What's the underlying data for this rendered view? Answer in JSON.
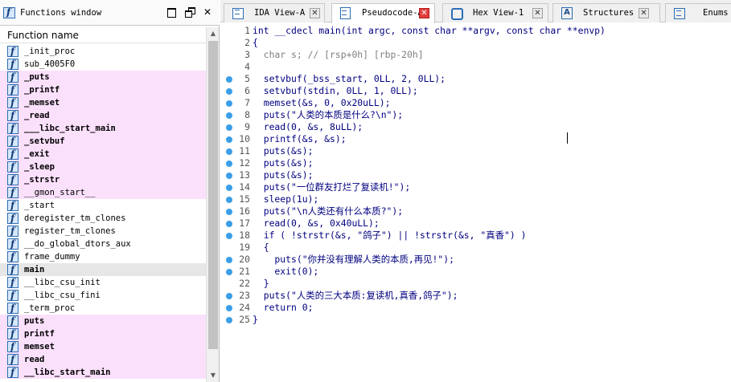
{
  "functions_window": {
    "title": "Functions window",
    "column_header": "Function name",
    "items": [
      {
        "name": "_init_proc",
        "kind": "normal"
      },
      {
        "name": "sub_4005F0",
        "kind": "normal"
      },
      {
        "name": "_puts",
        "kind": "lib"
      },
      {
        "name": "_printf",
        "kind": "lib"
      },
      {
        "name": "_memset",
        "kind": "lib"
      },
      {
        "name": "_read",
        "kind": "lib"
      },
      {
        "name": "___libc_start_main",
        "kind": "lib"
      },
      {
        "name": "_setvbuf",
        "kind": "lib"
      },
      {
        "name": "_exit",
        "kind": "lib"
      },
      {
        "name": "_sleep",
        "kind": "lib"
      },
      {
        "name": "_strstr",
        "kind": "lib"
      },
      {
        "name": "__gmon_start__",
        "kind": "lib_plain"
      },
      {
        "name": "_start",
        "kind": "normal"
      },
      {
        "name": "deregister_tm_clones",
        "kind": "normal"
      },
      {
        "name": "register_tm_clones",
        "kind": "normal"
      },
      {
        "name": "__do_global_dtors_aux",
        "kind": "normal"
      },
      {
        "name": "frame_dummy",
        "kind": "normal"
      },
      {
        "name": "main",
        "kind": "selected"
      },
      {
        "name": "__libc_csu_init",
        "kind": "normal"
      },
      {
        "name": "__libc_csu_fini",
        "kind": "normal"
      },
      {
        "name": "_term_proc",
        "kind": "normal"
      },
      {
        "name": "puts",
        "kind": "lib"
      },
      {
        "name": "printf",
        "kind": "lib"
      },
      {
        "name": "memset",
        "kind": "lib"
      },
      {
        "name": "read",
        "kind": "lib"
      },
      {
        "name": "__libc_start_main",
        "kind": "lib"
      }
    ]
  },
  "tabs": [
    {
      "label": "IDA View-A",
      "icon": "ida-view-icon",
      "active": false
    },
    {
      "label": "Pseudocode-A",
      "icon": "pseudocode-icon",
      "active": true
    },
    {
      "label": "Hex View-1",
      "icon": "hex-view-icon",
      "active": false
    },
    {
      "label": "Structures",
      "icon": "structures-icon",
      "active": false
    },
    {
      "label": "Enums",
      "icon": "enums-icon",
      "active": false
    }
  ],
  "code_lines": [
    {
      "n": "1",
      "bp": false,
      "text": "int __cdecl main(int argc, const char **argv, const char **envp)"
    },
    {
      "n": "2",
      "bp": false,
      "text": "{"
    },
    {
      "n": "3",
      "bp": false,
      "text": "  char s; // [rsp+0h] [rbp-20h]",
      "comment": true
    },
    {
      "n": "4",
      "bp": false,
      "text": ""
    },
    {
      "n": "5",
      "bp": true,
      "text": "  setvbuf(_bss_start, 0LL, 2, 0LL);"
    },
    {
      "n": "6",
      "bp": true,
      "text": "  setvbuf(stdin, 0LL, 1, 0LL);"
    },
    {
      "n": "7",
      "bp": true,
      "text": "  memset(&s, 0, 0x20uLL);"
    },
    {
      "n": "8",
      "bp": true,
      "text": "  puts(\"人类的本质是什么?\\n\");"
    },
    {
      "n": "9",
      "bp": true,
      "text": "  read(0, &s, 8uLL);"
    },
    {
      "n": "10",
      "bp": true,
      "text": "  printf(&s, &s);"
    },
    {
      "n": "11",
      "bp": true,
      "text": "  puts(&s);"
    },
    {
      "n": "12",
      "bp": true,
      "text": "  puts(&s);"
    },
    {
      "n": "13",
      "bp": true,
      "text": "  puts(&s);"
    },
    {
      "n": "14",
      "bp": true,
      "text": "  puts(\"一位群友打烂了复读机!\");"
    },
    {
      "n": "15",
      "bp": true,
      "text": "  sleep(1u);"
    },
    {
      "n": "16",
      "bp": true,
      "text": "  puts(\"\\n人类还有什么本质?\");"
    },
    {
      "n": "17",
      "bp": true,
      "text": "  read(0, &s, 0x40uLL);"
    },
    {
      "n": "18",
      "bp": true,
      "text": "  if ( !strstr(&s, \"鸽子\") || !strstr(&s, \"真香\") )"
    },
    {
      "n": "19",
      "bp": false,
      "text": "  {"
    },
    {
      "n": "20",
      "bp": true,
      "text": "    puts(\"你并没有理解人类的本质,再见!\");"
    },
    {
      "n": "21",
      "bp": true,
      "text": "    exit(0);"
    },
    {
      "n": "22",
      "bp": false,
      "text": "  }"
    },
    {
      "n": "23",
      "bp": true,
      "text": "  puts(\"人类的三大本质:复读机,真香,鸽子\");"
    },
    {
      "n": "24",
      "bp": true,
      "text": "  return 0;"
    },
    {
      "n": "25",
      "bp": true,
      "text": "}"
    }
  ]
}
